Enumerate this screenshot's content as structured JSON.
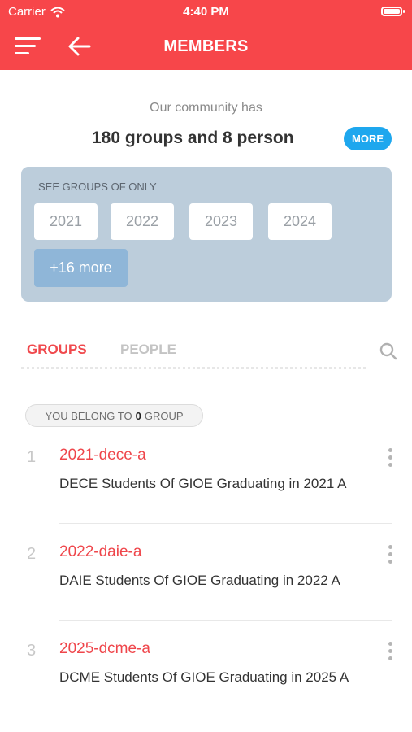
{
  "status_bar": {
    "carrier": "Carrier",
    "time": "4:40 PM"
  },
  "header": {
    "title": "MEMBERS"
  },
  "icons": {
    "menu": "hamburger-menu-icon",
    "back": "arrow-left-icon",
    "search": "magnifier-icon",
    "options": "vertical-dots-icon"
  },
  "summary": {
    "intro": "Our community has",
    "headline": "180 groups and 8 person",
    "more_label": "MORE"
  },
  "filter": {
    "label": "SEE GROUPS OF ONLY",
    "years": [
      "2021",
      "2022",
      "2023",
      "2024"
    ],
    "more_label": "+16 more"
  },
  "tabs": {
    "groups": "GROUPS",
    "people": "PEOPLE",
    "active": "GROUPS"
  },
  "belong": {
    "prefix": "YOU BELONG TO",
    "count": "0",
    "suffix": "GROUP"
  },
  "groups": [
    {
      "index": "1",
      "code": "2021-dece-a",
      "description": "DECE Students Of GIOE Graduating in 2021 A"
    },
    {
      "index": "2",
      "code": "2022-daie-a",
      "description": "DAIE Students Of GIOE Graduating in 2022 A"
    },
    {
      "index": "3",
      "code": "2025-dcme-a",
      "description": "DCME Students Of GIOE Graduating in 2025 A"
    }
  ],
  "colors": {
    "brand": "#f7464a",
    "accent_blue": "#1ea7ee",
    "filter_bg": "#bccddb",
    "more_chip": "#8fb6d8"
  }
}
